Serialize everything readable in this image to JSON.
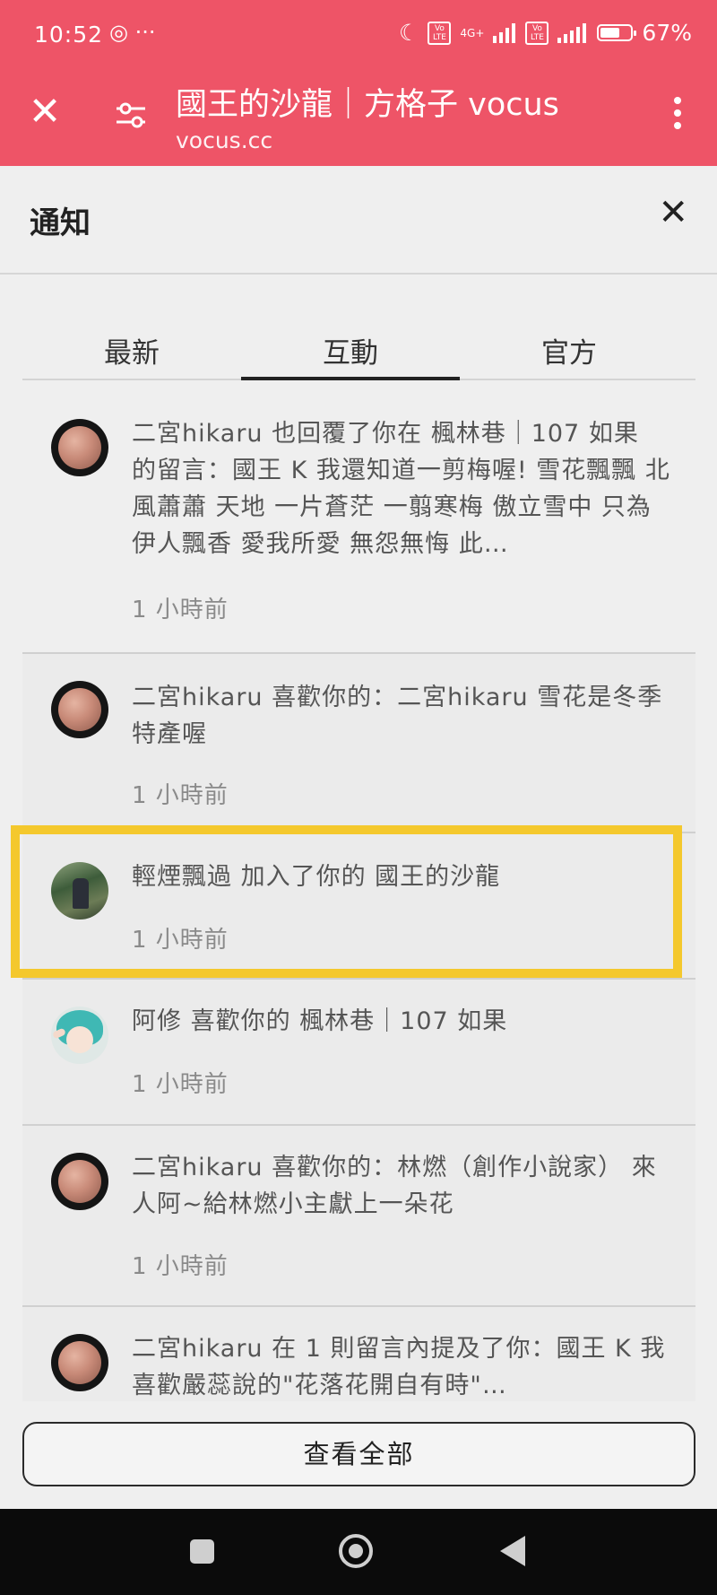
{
  "status_bar": {
    "time": "10:52",
    "extra_icons": "···",
    "battery_label": "67%",
    "battery_level": 0.67,
    "network": "4G+"
  },
  "browser": {
    "title": "國王的沙龍｜方格子 vocus",
    "url": "vocus.cc"
  },
  "panel": {
    "title": "通知",
    "tabs": [
      "最新",
      "互動",
      "官方"
    ],
    "active_tab": 1,
    "view_all_label": "查看全部"
  },
  "notifications": [
    {
      "avatar": "planet-avatar",
      "text": "二宮hikaru 也回覆了你在 楓林巷｜107 如果 的留言：國王 K 我還知道一剪梅喔! 雪花飄飄 北風蕭蕭 天地 一片蒼茫 一翦寒梅 傲立雪中 只為 伊人飄香 愛我所愛 無怨無悔 此…",
      "time": "1 小時前"
    },
    {
      "avatar": "planet-avatar",
      "text": "二宮hikaru 喜歡你的：二宮hikaru 雪花是冬季特產喔",
      "time": "1 小時前"
    },
    {
      "avatar": "photo-avatar",
      "text": "輕煙飄過 加入了你的 國王的沙龍",
      "time": "1 小時前",
      "highlighted": true
    },
    {
      "avatar": "anime-avatar",
      "text": "阿修 喜歡你的 楓林巷｜107 如果",
      "time": "1 小時前"
    },
    {
      "avatar": "planet-avatar",
      "text": "二宮hikaru 喜歡你的：林燃（創作小說家） 來人阿~給林燃小主獻上一朵花",
      "time": "1 小時前"
    },
    {
      "avatar": "planet-avatar",
      "text": "二宮hikaru 在 1 則留言內提及了你：國王 K 我喜歡嚴蕊說的\"花落花開自有時\"…",
      "time": ""
    }
  ],
  "colors": {
    "header_bg": "#ee5467",
    "highlight": "#f4c82d"
  }
}
